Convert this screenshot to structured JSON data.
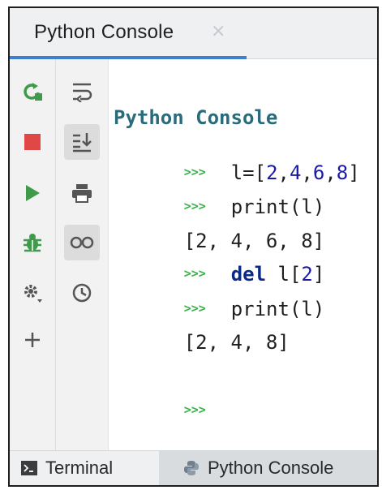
{
  "tab": {
    "label": "Python Console",
    "close_glyph": "×"
  },
  "toolbar_left": {
    "items": [
      {
        "icon": "rerun-icon",
        "color": "#3f9b4a"
      },
      {
        "icon": "stop-icon",
        "color": "#e04848"
      },
      {
        "icon": "execute-icon",
        "color": "#3f9b4a"
      },
      {
        "icon": "debug-bug-icon",
        "color": "#3f9b4a"
      },
      {
        "icon": "settings-gear-icon",
        "color": "#555555"
      },
      {
        "icon": "add-plus-icon",
        "color": "#555555"
      }
    ]
  },
  "toolbar_right": {
    "items": [
      {
        "icon": "soft-wrap-icon",
        "active": false
      },
      {
        "icon": "scroll-to-end-icon",
        "active": true
      },
      {
        "icon": "print-icon",
        "active": false
      },
      {
        "icon": "show-variables-icon",
        "active": true
      },
      {
        "icon": "history-clock-icon",
        "active": false
      }
    ]
  },
  "console": {
    "banner": "Python Console",
    "prompt": ">>>",
    "lines": [
      {
        "type": "input",
        "text": "l=[2,4,6,8]"
      },
      {
        "type": "input",
        "text": "print(l)"
      },
      {
        "type": "output",
        "text": "[2, 4, 6, 8]"
      },
      {
        "type": "input",
        "keyword": "del",
        "text": "l[2]"
      },
      {
        "type": "input",
        "text": "print(l)"
      },
      {
        "type": "output",
        "text": "[2, 4, 8]"
      }
    ],
    "empty_prompt": ">>>"
  },
  "bottom_tabs": [
    {
      "label": "Terminal",
      "icon": "terminal-icon",
      "active": false
    },
    {
      "label": "Python Console",
      "icon": "python-icon",
      "active": true
    }
  ],
  "colors": {
    "accent": "#3f7fd0",
    "prompt": "#38b34a",
    "number": "#1a1aa6",
    "banner": "#2a6b7a"
  }
}
